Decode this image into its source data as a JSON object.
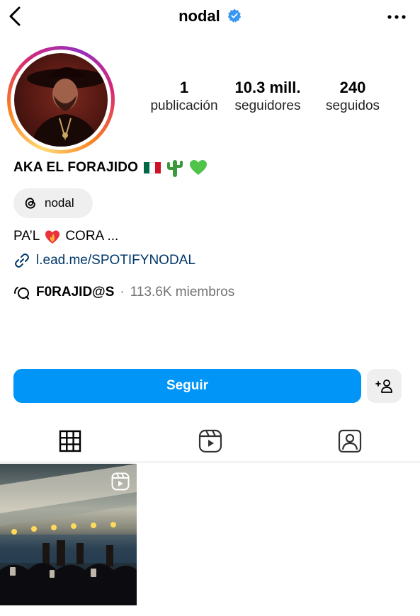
{
  "header": {
    "username": "nodal",
    "verified": true,
    "back_icon": "chevron-left-icon",
    "more_icon": "ellipsis-icon",
    "verified_color": "#3897f0"
  },
  "profile": {
    "stats": [
      {
        "value": "1",
        "label": "publicación"
      },
      {
        "value": "10.3 mill.",
        "label": "seguidores"
      },
      {
        "value": "240",
        "label": "seguidos"
      }
    ],
    "name": "AKA EL FORAJIDO",
    "threads_handle": "nodal",
    "bio": "PA’L",
    "bio_rest": "CORA ...",
    "link": "l.ead.me/SPOTIFYNODAL",
    "channel": {
      "name": "F0RAJID@S",
      "separator": "·",
      "members": "113.6K miembros"
    }
  },
  "actions": {
    "follow_label": "Seguir",
    "follow_color": "#0095f6",
    "suggest_icon": "add-person-icon",
    "suggest_label": "+"
  },
  "tabs": [
    {
      "name": "grid",
      "icon": "grid-icon",
      "active": true
    },
    {
      "name": "reels",
      "icon": "reels-icon",
      "active": false
    },
    {
      "name": "tagged",
      "icon": "tagged-icon",
      "active": false
    }
  ],
  "posts": [
    {
      "type": "reel",
      "icon": "reel-icon"
    }
  ]
}
